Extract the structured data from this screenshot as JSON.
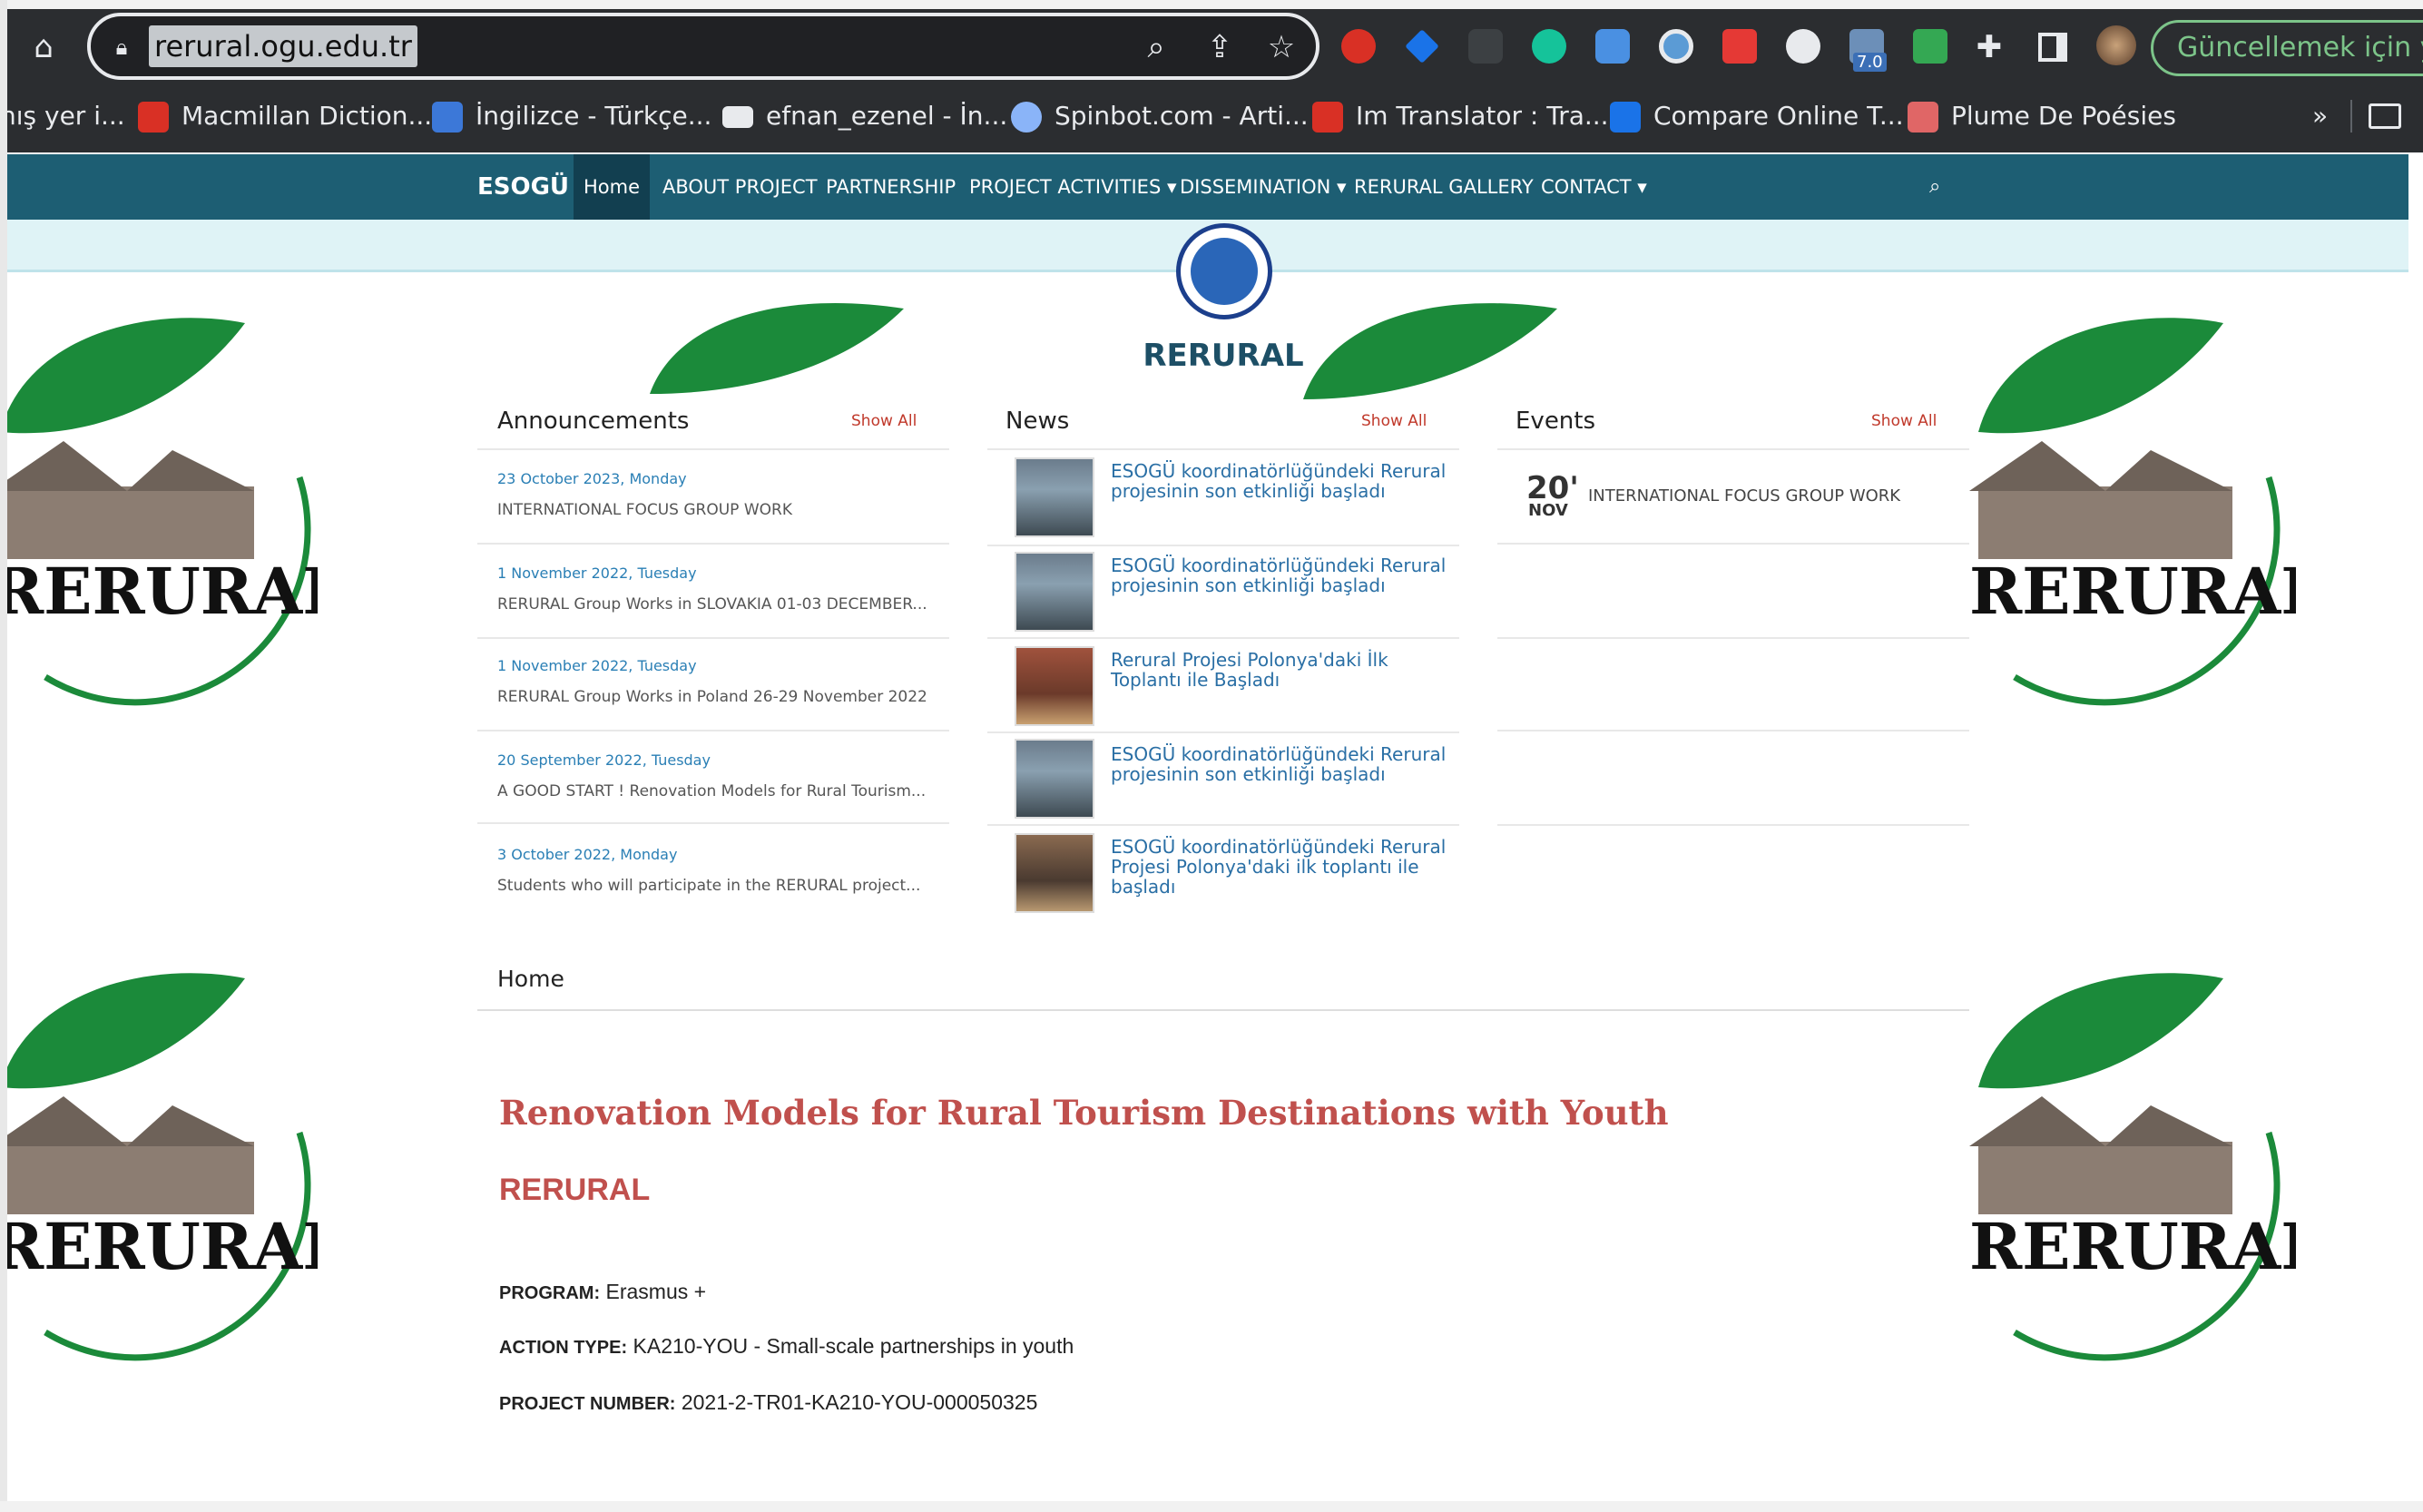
{
  "browser": {
    "url": "rerural.ogu.edu.tr",
    "update_button": "Güncellemek için ye",
    "ext_badge": "7.0",
    "bookmarks": [
      {
        "label": "nış yer i...",
        "color": "#888888"
      },
      {
        "label": "Macmillan Diction...",
        "color": "#d93025"
      },
      {
        "label": "İngilizce - Türkçe...",
        "color": "#3c78d8"
      },
      {
        "label": "efnan_ezenel - İn...",
        "color": "#e8eaed"
      },
      {
        "label": "Spinbot.com - Arti...",
        "color": "#8ab4f8"
      },
      {
        "label": "Im Translator : Tra...",
        "color": "#d93025"
      },
      {
        "label": "Compare Online T...",
        "color": "#1a73e8"
      },
      {
        "label": "Plume De Poésies",
        "color": "#e06666"
      }
    ],
    "bookmarks_overflow": "»"
  },
  "nav": {
    "brand": "ESOGÜ",
    "items": [
      "Home",
      "ABOUT PROJECT",
      "PARTNERSHIP",
      "PROJECT ACTIVITIES ▾",
      "DISSEMINATION ▾",
      "RERURAL GALLERY",
      "CONTACT ▾"
    ]
  },
  "site": {
    "title": "RERURAL",
    "emblem_text": "RERURAL"
  },
  "announcements": {
    "heading": "Announcements",
    "show_all": "Show All",
    "items": [
      {
        "date": "23 October 2023, Monday",
        "text": "INTERNATIONAL FOCUS GROUP WORK"
      },
      {
        "date": "1 November 2022, Tuesday",
        "text": "RERURAL Group Works in SLOVAKIA 01-03 DECEMBER..."
      },
      {
        "date": "1 November 2022, Tuesday",
        "text": "RERURAL Group Works in Poland 26-29 November 2022"
      },
      {
        "date": "20 September 2022, Tuesday",
        "text": "A GOOD START ! Renovation Models for Rural Tourism..."
      },
      {
        "date": "3 October 2022, Monday",
        "text": "Students who will participate in the RERURAL project..."
      }
    ]
  },
  "news": {
    "heading": "News",
    "show_all": "Show All",
    "items": [
      {
        "l1": "ESOGÜ koordinatörlüğündeki Rerural",
        "l2": "projesinin son etkinliği başladı",
        "l3": ""
      },
      {
        "l1": "ESOGÜ koordinatörlüğündeki Rerural",
        "l2": "projesinin son etkinliği başladı",
        "l3": ""
      },
      {
        "l1": "Rerural Projesi Polonya'daki İlk",
        "l2": "Toplantı ile Başladı",
        "l3": ""
      },
      {
        "l1": "ESOGÜ koordinatörlüğündeki Rerural",
        "l2": "projesinin son etkinliği başladı",
        "l3": ""
      },
      {
        "l1": "ESOGÜ koordinatörlüğündeki Rerural",
        "l2": "Projesi Polonya'daki ilk toplantı ile",
        "l3": "başladı"
      }
    ]
  },
  "events": {
    "heading": "Events",
    "show_all": "Show All",
    "items": [
      {
        "day": "20'",
        "month": "NOV",
        "text": "INTERNATIONAL FOCUS GROUP WORK"
      }
    ]
  },
  "content": {
    "breadcrumb": "Home",
    "title": "Renovation Models for Rural Tourism Destinations with Youth",
    "acronym": "RERURAL",
    "program_label": "PROGRAM:",
    "program_value": "Erasmus +",
    "action_label": "ACTION TYPE:",
    "action_value": "KA210-YOU - Small-scale partnerships in youth",
    "number_label": "PROJECT NUMBER:",
    "number_value": "2021-2-TR01-KA210-YOU-000050325"
  }
}
